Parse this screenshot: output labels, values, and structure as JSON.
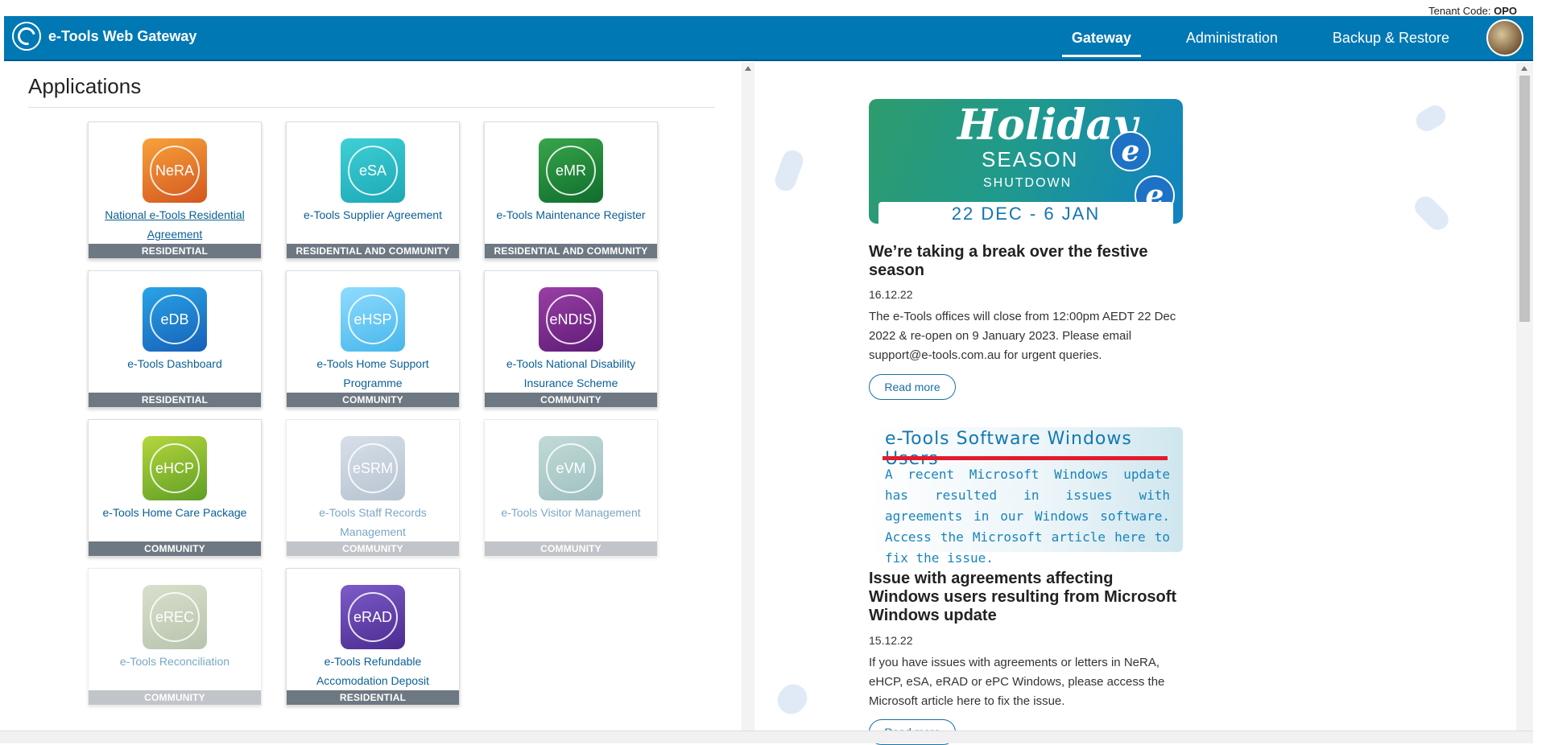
{
  "header": {
    "tenant_label": "Tenant Code:",
    "tenant_code": "OPO",
    "brand": "e-Tools Web Gateway",
    "nav": [
      {
        "label": "Gateway",
        "active": true
      },
      {
        "label": "Administration",
        "active": false
      },
      {
        "label": "Backup & Restore",
        "active": false
      }
    ],
    "avatar_icon": "user-avatar-icon"
  },
  "apps": {
    "title": "Applications",
    "cards": [
      {
        "abbr": "NeRA",
        "name": "National e-Tools Residential Agreement",
        "tag": "RESIDENTIAL",
        "color1": "#f7a23a",
        "color2": "#d4561f",
        "enabled": true,
        "link": true
      },
      {
        "abbr": "eSA",
        "name": "e-Tools Supplier Agreement",
        "tag": "RESIDENTIAL AND COMMUNITY",
        "color1": "#3fd0d6",
        "color2": "#1ba8b4",
        "enabled": true,
        "link": false
      },
      {
        "abbr": "eMR",
        "name": "e-Tools Maintenance Register",
        "tag": "RESIDENTIAL AND COMMUNITY",
        "color1": "#38a54a",
        "color2": "#0f6d2c",
        "enabled": true,
        "link": false
      },
      {
        "abbr": "eDB",
        "name": "e-Tools Dashboard",
        "tag": "RESIDENTIAL",
        "color1": "#2aa4e6",
        "color2": "#1560b7",
        "enabled": true,
        "link": false
      },
      {
        "abbr": "eHSP",
        "name": "e-Tools Home Support Programme",
        "tag": "COMMUNITY",
        "color1": "#8fdcff",
        "color2": "#46b6ea",
        "enabled": true,
        "link": false
      },
      {
        "abbr": "eNDIS",
        "name": "e-Tools National Disability Insurance Scheme",
        "tag": "COMMUNITY",
        "color1": "#9a3fa5",
        "color2": "#5e1b78",
        "enabled": true,
        "link": false
      },
      {
        "abbr": "eHCP",
        "name": "e-Tools Home Care Package",
        "tag": "COMMUNITY",
        "color1": "#b6d63c",
        "color2": "#5e9e25",
        "enabled": true,
        "link": false
      },
      {
        "abbr": "eSRM",
        "name": "e-Tools Staff Records Management",
        "tag": "COMMUNITY",
        "color1": "#b6c6d8",
        "color2": "#7c92ab",
        "enabled": false,
        "link": false
      },
      {
        "abbr": "eVM",
        "name": "e-Tools Visitor Management",
        "tag": "COMMUNITY",
        "color1": "#8fbdb8",
        "color2": "#4f8d8c",
        "enabled": false,
        "link": false
      },
      {
        "abbr": "eREC",
        "name": "e-Tools Reconciliation",
        "tag": "COMMUNITY",
        "color1": "#b9c8a3",
        "color2": "#7e946a",
        "enabled": false,
        "link": false
      },
      {
        "abbr": "eRAD",
        "name": "e-Tools Refundable Accomodation Deposit",
        "tag": "RESIDENTIAL",
        "color1": "#7d5cc9",
        "color2": "#4a2b8f",
        "enabled": true,
        "link": false
      }
    ]
  },
  "news": {
    "banner1": {
      "holiday": "Holiday",
      "season": "SEASON",
      "shutdown": "SHUTDOWN",
      "dates": "22 DEC - 6 JAN"
    },
    "item1": {
      "title": "We’re taking a break over the festive season",
      "date": "16.12.22",
      "body": "The e-Tools offices will close from 12:00pm AEDT 22 Dec 2022 & re-open on 9 January 2023. Please email support@e-tools.com.au for urgent queries.",
      "read_more": "Read more"
    },
    "banner2": {
      "title": "e-Tools Software Windows Users",
      "text": "A recent Microsoft Windows update has resulted in issues with agreements in our Windows software. Access the Microsoft article here to fix the issue."
    },
    "item2": {
      "title": "Issue with agreements affecting Windows users resulting from Microsoft Windows update",
      "date": "15.12.22",
      "body": "If you have issues with agreements or letters in NeRA, eHCP, eSA, eRAD or ePC Windows, please access the Microsoft article here to fix the issue.",
      "read_more": "Read more"
    }
  }
}
